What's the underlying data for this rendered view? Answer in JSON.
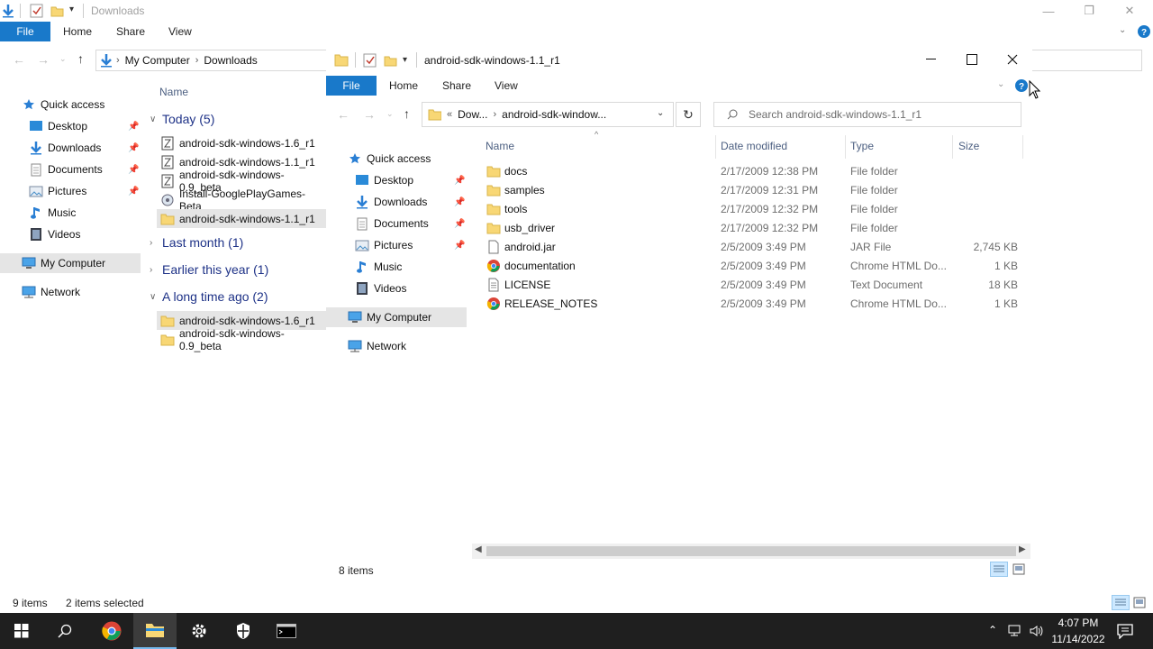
{
  "back_window": {
    "title": "Downloads",
    "tabs": {
      "file": "File",
      "home": "Home",
      "share": "Share",
      "view": "View"
    },
    "breadcrumb": [
      "My Computer",
      "Downloads"
    ],
    "nav": {
      "quick_access": "Quick access",
      "items": [
        "Desktop",
        "Downloads",
        "Documents",
        "Pictures",
        "Music",
        "Videos"
      ],
      "my_computer": "My Computer",
      "network": "Network"
    },
    "column_name": "Name",
    "groups": [
      {
        "label": "Today (5)",
        "expanded": true,
        "files": [
          {
            "name": "android-sdk-windows-1.6_r1",
            "icon": "zip-file-icon",
            "selected": false
          },
          {
            "name": "android-sdk-windows-1.1_r1",
            "icon": "zip-file-icon",
            "selected": false
          },
          {
            "name": "android-sdk-windows-0.9_beta",
            "icon": "zip-file-icon",
            "selected": false
          },
          {
            "name": "Install-GooglePlayGames-Beta",
            "icon": "installer-icon",
            "selected": false
          },
          {
            "name": "android-sdk-windows-1.1_r1",
            "icon": "folder-icon",
            "selected": true
          }
        ]
      },
      {
        "label": "Last month (1)",
        "expanded": false,
        "files": []
      },
      {
        "label": "Earlier this year (1)",
        "expanded": false,
        "files": []
      },
      {
        "label": "A long time ago (2)",
        "expanded": true,
        "files": [
          {
            "name": "android-sdk-windows-1.6_r1",
            "icon": "folder-icon",
            "selected": true
          },
          {
            "name": "android-sdk-windows-0.9_beta",
            "icon": "folder-icon",
            "selected": false
          }
        ]
      }
    ],
    "status": {
      "items": "9 items",
      "selected": "2 items selected"
    }
  },
  "front_window": {
    "title": "android-sdk-windows-1.1_r1",
    "tabs": {
      "file": "File",
      "home": "Home",
      "share": "Share",
      "view": "View"
    },
    "breadcrumb": {
      "overflow": "«",
      "parent": "Dow...",
      "current": "android-sdk-window..."
    },
    "search_placeholder": "Search android-sdk-windows-1.1_r1",
    "nav": {
      "quick_access": "Quick access",
      "items": [
        "Desktop",
        "Downloads",
        "Documents",
        "Pictures",
        "Music",
        "Videos"
      ],
      "my_computer": "My Computer",
      "network": "Network"
    },
    "columns": {
      "name": "Name",
      "date": "Date modified",
      "type": "Type",
      "size": "Size"
    },
    "files": [
      {
        "name": "docs",
        "date": "2/17/2009 12:38 PM",
        "type": "File folder",
        "size": "",
        "icon": "folder-icon"
      },
      {
        "name": "samples",
        "date": "2/17/2009 12:31 PM",
        "type": "File folder",
        "size": "",
        "icon": "folder-icon"
      },
      {
        "name": "tools",
        "date": "2/17/2009 12:32 PM",
        "type": "File folder",
        "size": "",
        "icon": "folder-icon"
      },
      {
        "name": "usb_driver",
        "date": "2/17/2009 12:32 PM",
        "type": "File folder",
        "size": "",
        "icon": "folder-icon"
      },
      {
        "name": "android.jar",
        "date": "2/5/2009 3:49 PM",
        "type": "JAR File",
        "size": "2,745 KB",
        "icon": "file-icon"
      },
      {
        "name": "documentation",
        "date": "2/5/2009 3:49 PM",
        "type": "Chrome HTML Do...",
        "size": "1 KB",
        "icon": "chrome-icon"
      },
      {
        "name": "LICENSE",
        "date": "2/5/2009 3:49 PM",
        "type": "Text Document",
        "size": "18 KB",
        "icon": "text-file-icon"
      },
      {
        "name": "RELEASE_NOTES",
        "date": "2/5/2009 3:49 PM",
        "type": "Chrome HTML Do...",
        "size": "1 KB",
        "icon": "chrome-icon"
      }
    ],
    "status": {
      "items": "8 items"
    }
  },
  "taskbar": {
    "time": "4:07 PM",
    "date": "11/14/2022"
  },
  "colors": {
    "accent": "#1979ca",
    "selection": "#cce8ff",
    "folder": "#f8d775",
    "taskbar": "#1f1f1f"
  }
}
